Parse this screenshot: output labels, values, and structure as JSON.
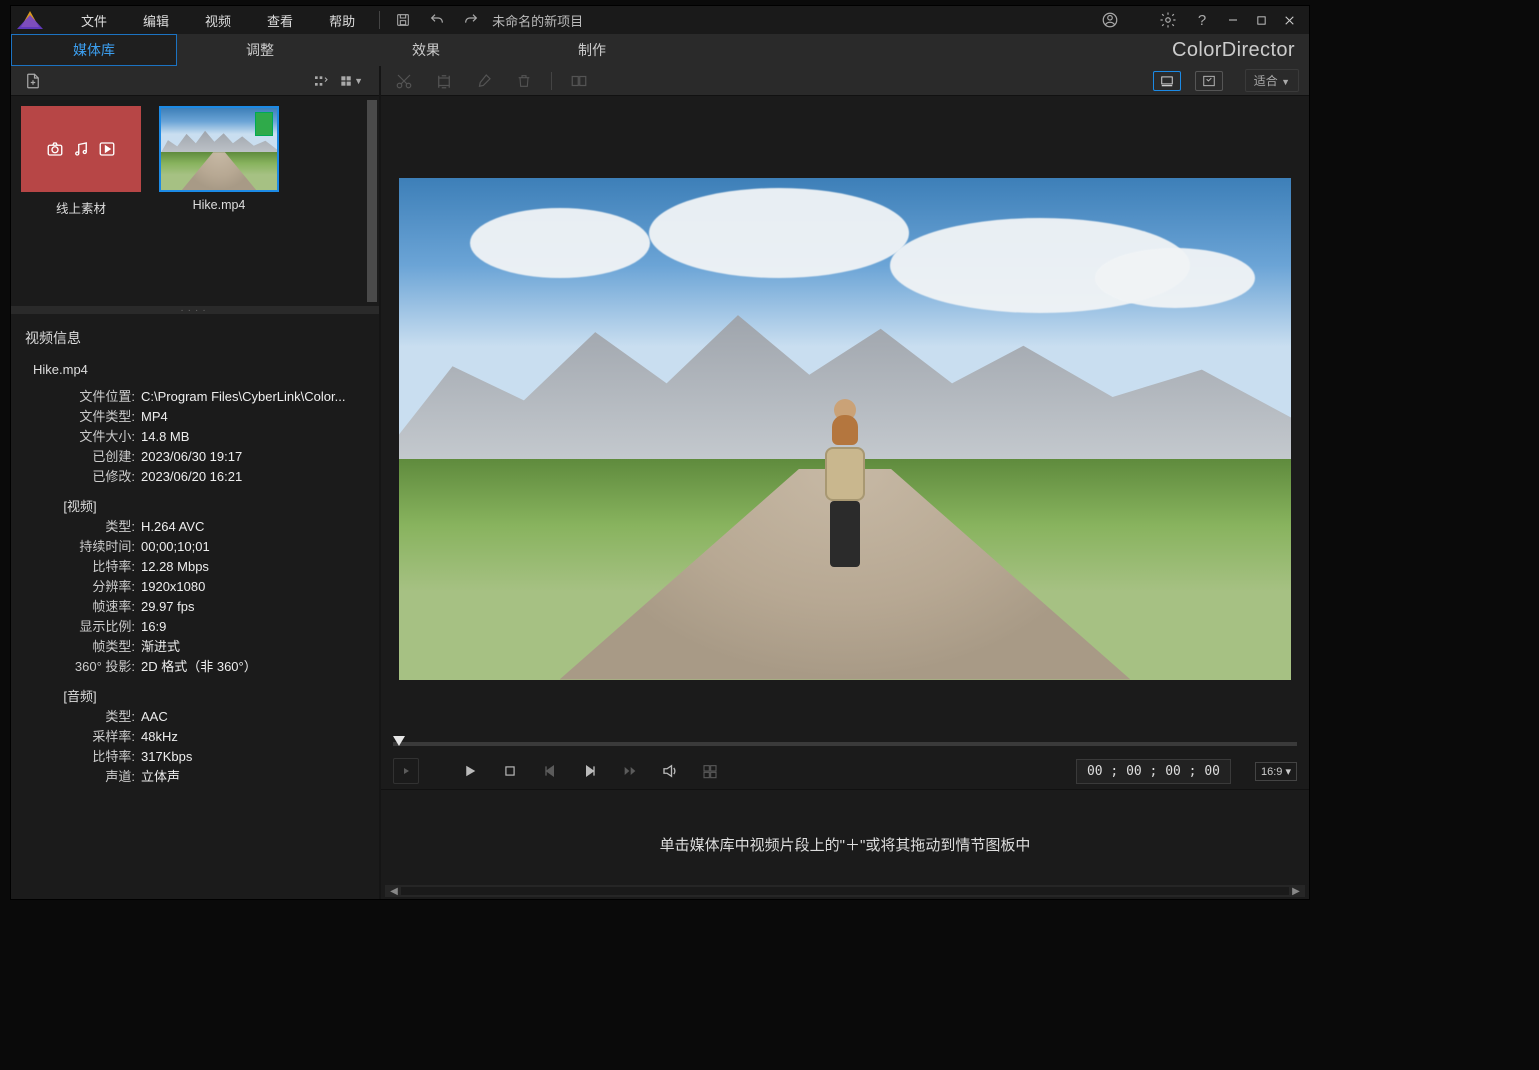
{
  "titlebar": {
    "menus": [
      "文件",
      "编辑",
      "视频",
      "查看",
      "帮助"
    ],
    "project_title": "未命名的新项目"
  },
  "brand": {
    "tabs": [
      "媒体库",
      "调整",
      "效果",
      "制作"
    ],
    "active_index": 0,
    "product_name": "ColorDirector"
  },
  "library": {
    "items": [
      {
        "label": "线上素材",
        "type": "online"
      },
      {
        "label": "Hike.mp4",
        "type": "clip",
        "selected": true
      }
    ]
  },
  "info": {
    "panel_title": "视频信息",
    "filename": "Hike.mp4",
    "general": [
      {
        "label": "文件位置:",
        "value": "C:\\Program Files\\CyberLink\\Color..."
      },
      {
        "label": "文件类型:",
        "value": "MP4"
      },
      {
        "label": "文件大小:",
        "value": "14.8 MB"
      },
      {
        "label": "已创建:",
        "value": "2023/06/30 19:17"
      },
      {
        "label": "已修改:",
        "value": "2023/06/20 16:21"
      }
    ],
    "video_header": "[视频]",
    "video": [
      {
        "label": "类型:",
        "value": "H.264 AVC"
      },
      {
        "label": "持续时间:",
        "value": "00;00;10;01"
      },
      {
        "label": "比特率:",
        "value": "12.28 Mbps"
      },
      {
        "label": "分辨率:",
        "value": "1920x1080"
      },
      {
        "label": "帧速率:",
        "value": "29.97 fps"
      },
      {
        "label": "显示比例:",
        "value": "16:9"
      },
      {
        "label": "帧类型:",
        "value": "渐进式"
      },
      {
        "label": "360° 投影:",
        "value": "2D 格式（非 360°）"
      }
    ],
    "audio_header": "[音频]",
    "audio": [
      {
        "label": "类型:",
        "value": "AAC"
      },
      {
        "label": "采样率:",
        "value": "48kHz"
      },
      {
        "label": "比特率:",
        "value": "317Kbps"
      },
      {
        "label": "声道:",
        "value": "立体声"
      }
    ]
  },
  "preview": {
    "zoom_label": "适合",
    "timecode": "00 ; 00 ; 00 ; 00",
    "aspect_label": "16:9 ▾"
  },
  "storyboard": {
    "hint": "单击媒体库中视频片段上的\"＋\"或将其拖动到情节图板中"
  }
}
